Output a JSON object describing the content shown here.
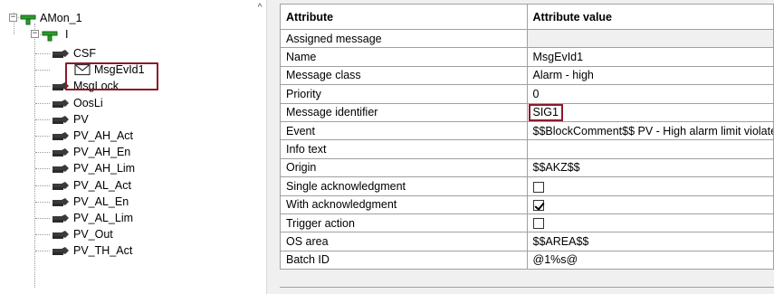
{
  "tree": {
    "root": {
      "label": "AMon_1",
      "expander": "−"
    },
    "group": {
      "label": "I",
      "expander": "−"
    },
    "items": [
      {
        "label": "CSF",
        "icon": "tag-icon"
      },
      {
        "label": "MsgEvId1",
        "icon": "message-icon",
        "selected": true
      },
      {
        "label": "MsgLock",
        "icon": "tag-icon"
      },
      {
        "label": "OosLi",
        "icon": "tag-icon"
      },
      {
        "label": "PV",
        "icon": "tag-icon"
      },
      {
        "label": "PV_AH_Act",
        "icon": "tag-icon"
      },
      {
        "label": "PV_AH_En",
        "icon": "tag-icon"
      },
      {
        "label": "PV_AH_Lim",
        "icon": "tag-icon"
      },
      {
        "label": "PV_AL_Act",
        "icon": "tag-icon"
      },
      {
        "label": "PV_AL_En",
        "icon": "tag-icon"
      },
      {
        "label": "PV_AL_Lim",
        "icon": "tag-icon"
      },
      {
        "label": "PV_Out",
        "icon": "tag-icon"
      },
      {
        "label": "PV_TH_Act",
        "icon": "tag-icon"
      }
    ],
    "scroll_up_glyph": "^"
  },
  "grid": {
    "headers": {
      "attribute": "Attribute",
      "value": "Attribute value"
    },
    "rows": [
      {
        "name": "Assigned message",
        "value": "",
        "kind": "disabled"
      },
      {
        "name": "Name",
        "value": "MsgEvId1",
        "kind": "text"
      },
      {
        "name": "Message class",
        "value": "Alarm - high",
        "kind": "text"
      },
      {
        "name": "Priority",
        "value": "0",
        "kind": "text"
      },
      {
        "name": "Message identifier",
        "value": "SIG1",
        "kind": "text",
        "highlighted": true
      },
      {
        "name": "Event",
        "value": "$$BlockComment$$ PV - High alarm limit violated",
        "kind": "text"
      },
      {
        "name": "Info text",
        "value": "",
        "kind": "text"
      },
      {
        "name": "Origin",
        "value": "$$AKZ$$",
        "kind": "text"
      },
      {
        "name": "Single acknowledgment",
        "checked": false,
        "kind": "checkbox"
      },
      {
        "name": "With acknowledgment",
        "checked": true,
        "kind": "checkbox"
      },
      {
        "name": "Trigger action",
        "checked": false,
        "kind": "checkbox"
      },
      {
        "name": "OS area",
        "value": "$$AREA$$",
        "kind": "text"
      },
      {
        "name": "Batch ID",
        "value": "@1%s@",
        "kind": "text"
      }
    ]
  },
  "colors": {
    "highlight_border": "#8b1a2b",
    "grid_line": "#a0a0a0",
    "pane_bg": "#f0f0f0"
  }
}
